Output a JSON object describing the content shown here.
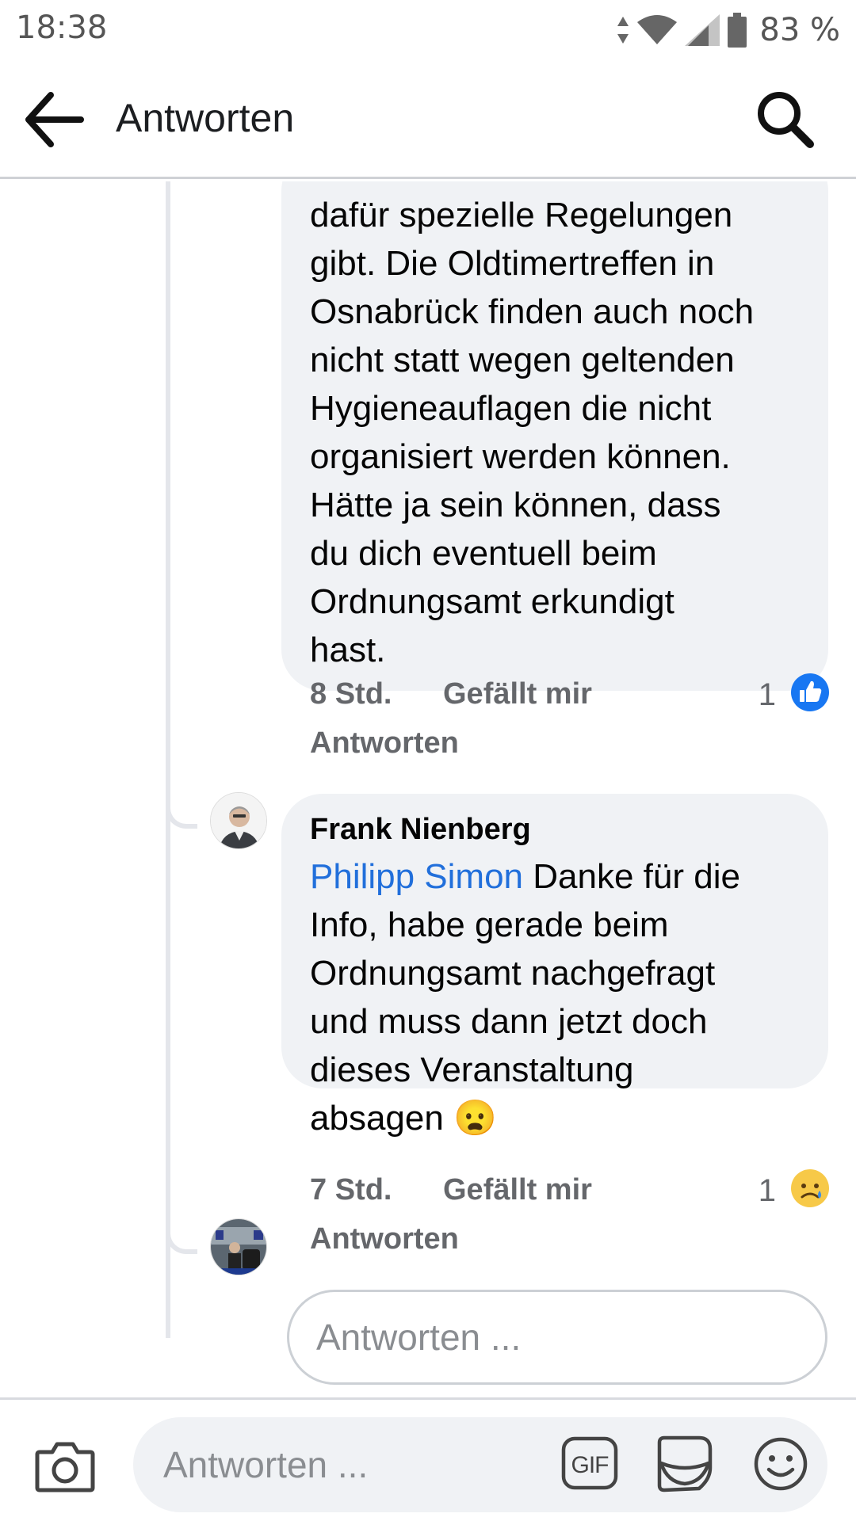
{
  "status_bar": {
    "time": "18:38",
    "battery": "83 %"
  },
  "app_bar": {
    "title": "Antworten"
  },
  "comments": [
    {
      "text": "dafür spezielle Regelungen\ngibt. Die Oldtimertreffen in\nOsnabrück finden auch noch\nnicht statt wegen geltenden\nHygieneauflagen die nicht\norganisiert werden können.\nHätte ja sein können, dass\ndu dich eventuell beim\nOrdnungsamt erkundigt\nhast.",
      "time": "8 Std.",
      "like_label": "Gefällt mir",
      "reply_label": "Antworten",
      "reaction_count": "1",
      "reaction": "like-icon"
    },
    {
      "author": "Frank Nienberg",
      "mention": "Philipp Simon",
      "text": " Danke für die\nInfo, habe gerade beim\nOrdnungsamt nachgefragt\nund muss dann jetzt doch\ndieses Veranstaltung\nabsagen ",
      "emoji": "😦",
      "time": "7 Std.",
      "like_label": "Gefällt mir",
      "reply_label": "Antworten",
      "reaction_count": "1",
      "reaction": "sad-icon"
    }
  ],
  "reply_input": {
    "placeholder": "Antworten ..."
  },
  "composer": {
    "placeholder": "Antworten ..."
  },
  "colors": {
    "accent": "#1877f2",
    "mention": "#216fdb",
    "bubble": "#f0f2f5",
    "meta": "#65676b"
  }
}
